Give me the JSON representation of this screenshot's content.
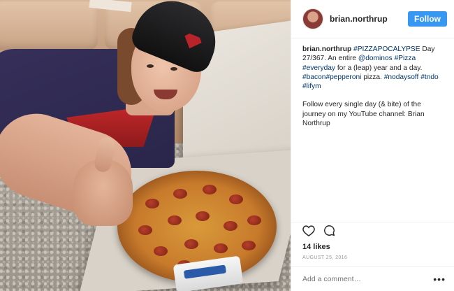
{
  "header": {
    "username": "brian.northrup",
    "follow_label": "Follow"
  },
  "caption": {
    "username": "brian.northrup",
    "tag_pizzapocalypse": "#PIZZAPOCALYPSE",
    "text_1": " Day 27/367. An entire ",
    "mention_dominos": "@dominos",
    "text_2": " ",
    "tag_pizza": "#Pizza",
    "text_3": " ",
    "tag_everyday": "#everyday",
    "text_4": " for a (leap) year and a day. ",
    "tag_bacon": "#bacon",
    "tag_pepperoni": "#pepperoni",
    "text_5": " pizza. ",
    "tag_nodaysoff": "#nodaysoff",
    "text_6": " ",
    "tag_tndo": "#tndo",
    "text_7": " ",
    "tag_lifym": "#lifym",
    "paragraph_2": "Follow every single day (& bite) of the journey on my YouTube channel: Brian Northrup"
  },
  "actions": {
    "like_icon": "heart-icon",
    "comment_icon": "comment-icon"
  },
  "likes": "14 likes",
  "date": "AUGUST 25, 2016",
  "comment": {
    "placeholder": "Add a comment…",
    "more_icon": "more-options-icon"
  },
  "photo": {
    "sauce_label": "DOMINOS"
  }
}
